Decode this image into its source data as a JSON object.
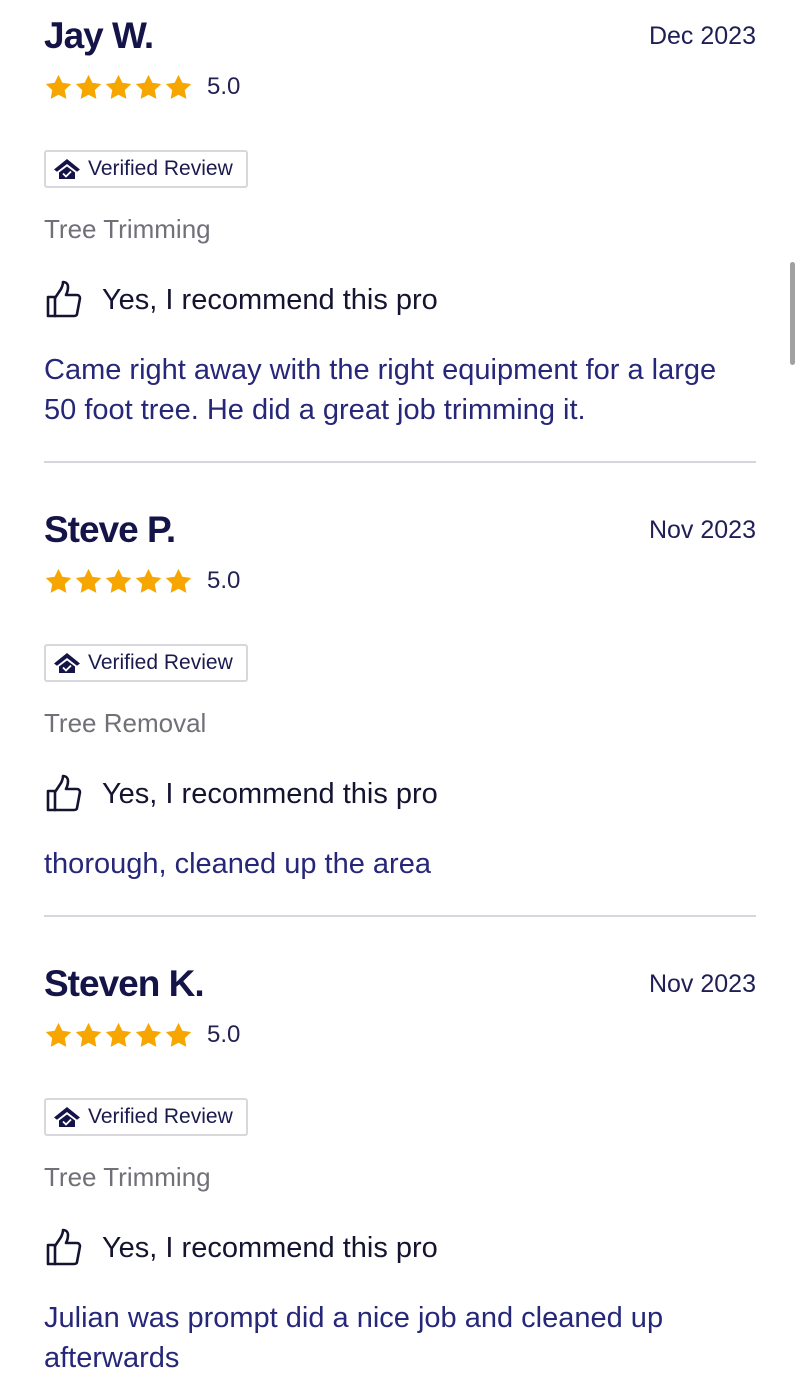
{
  "reviews": [
    {
      "name": "Jay W.",
      "date": "Dec 2023",
      "rating": "5.0",
      "stars": 5,
      "verified_label": "Verified Review",
      "service": "Tree Trimming",
      "recommendation": "Yes, I recommend this pro",
      "text": "Came right away with the right equipment for a large 50 foot tree. He did a great job trimming it."
    },
    {
      "name": "Steve P.",
      "date": "Nov 2023",
      "rating": "5.0",
      "stars": 5,
      "verified_label": "Verified Review",
      "service": "Tree Removal",
      "recommendation": "Yes, I recommend this pro",
      "text": "thorough, cleaned up the area"
    },
    {
      "name": "Steven K.",
      "date": "Nov 2023",
      "rating": "5.0",
      "stars": 5,
      "verified_label": "Verified Review",
      "service": "Tree Trimming",
      "recommendation": "Yes, I recommend this pro",
      "text": "Julian was prompt did a nice job and cleaned up afterwards"
    }
  ],
  "icons": {
    "star": "star-icon",
    "verified": "verified-house-icon",
    "recommend": "thumbs-up-icon"
  },
  "colors": {
    "star": "#f7a600",
    "name": "#141449",
    "review_text": "#27277a",
    "service": "#707078",
    "divider": "#d6d6dc",
    "badge_border": "#d7d7dc"
  }
}
